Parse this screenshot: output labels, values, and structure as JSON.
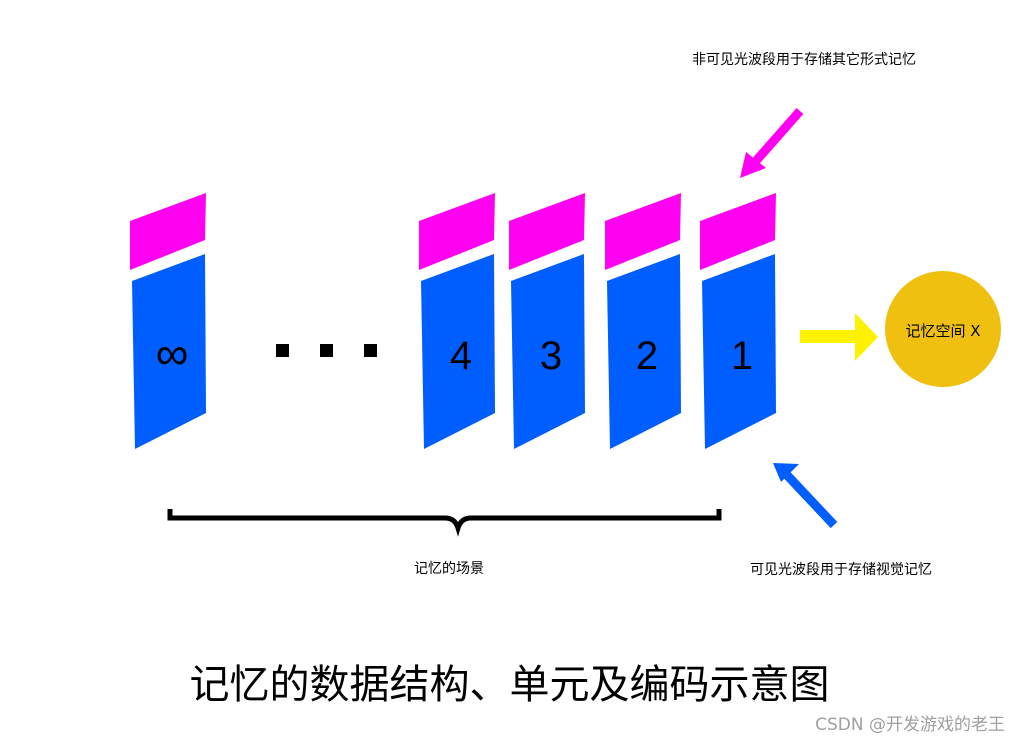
{
  "colors": {
    "magenta": "#ff00f0",
    "blue": "#005efe",
    "yellow": "#fff200",
    "gold": "#f0c011"
  },
  "units": [
    {
      "label": "∞"
    },
    {
      "label": "4"
    },
    {
      "label": "3"
    },
    {
      "label": "2"
    },
    {
      "label": "1"
    }
  ],
  "ellipsis": "...",
  "labels": {
    "invisible_band": "非可见光波段用于存储其它形式记忆",
    "visible_band": "可见光波段用于存储视觉记忆",
    "scene": "记忆的场景",
    "memory_space": "记忆空间 X"
  },
  "title": "记忆的数据结构、单元及编码示意图",
  "watermark": "CSDN @开发游戏的老王"
}
